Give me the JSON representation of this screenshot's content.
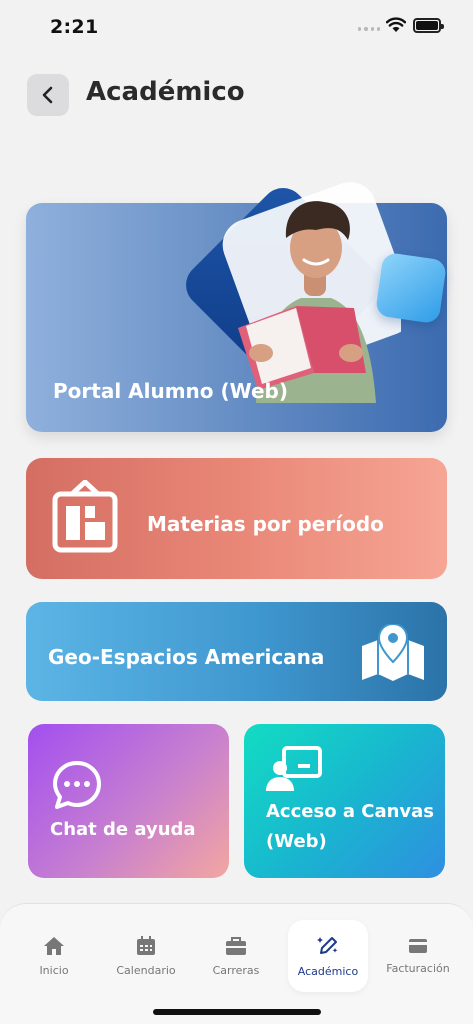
{
  "status_bar": {
    "time": "2:21"
  },
  "header": {
    "title": "Académico"
  },
  "cards": {
    "portal": {
      "label": "Portal Alumno (Web)"
    },
    "materias": {
      "label": "Materias por período"
    },
    "geo": {
      "label": "Geo-Espacios Americana"
    },
    "chat": {
      "label": "Chat de ayuda"
    },
    "canvas": {
      "label": "Acceso a Canvas (Web)"
    }
  },
  "nav": {
    "items": [
      {
        "label": "Inicio",
        "icon": "home-icon"
      },
      {
        "label": "Calendario",
        "icon": "calendar-icon"
      },
      {
        "label": "Carreras",
        "icon": "briefcase-icon"
      },
      {
        "label": "Académico",
        "icon": "edit-sparkle-icon",
        "active": true
      },
      {
        "label": "Facturación",
        "icon": "credit-card-icon"
      }
    ]
  },
  "colors": {
    "nav_active": "#1e3a8a",
    "portal_card": "#6f95c9",
    "materias_card": "#e98777",
    "geo_card": "#3f97cf",
    "chat_card": "#c77fd0",
    "canvas_card": "#18b7cf"
  }
}
